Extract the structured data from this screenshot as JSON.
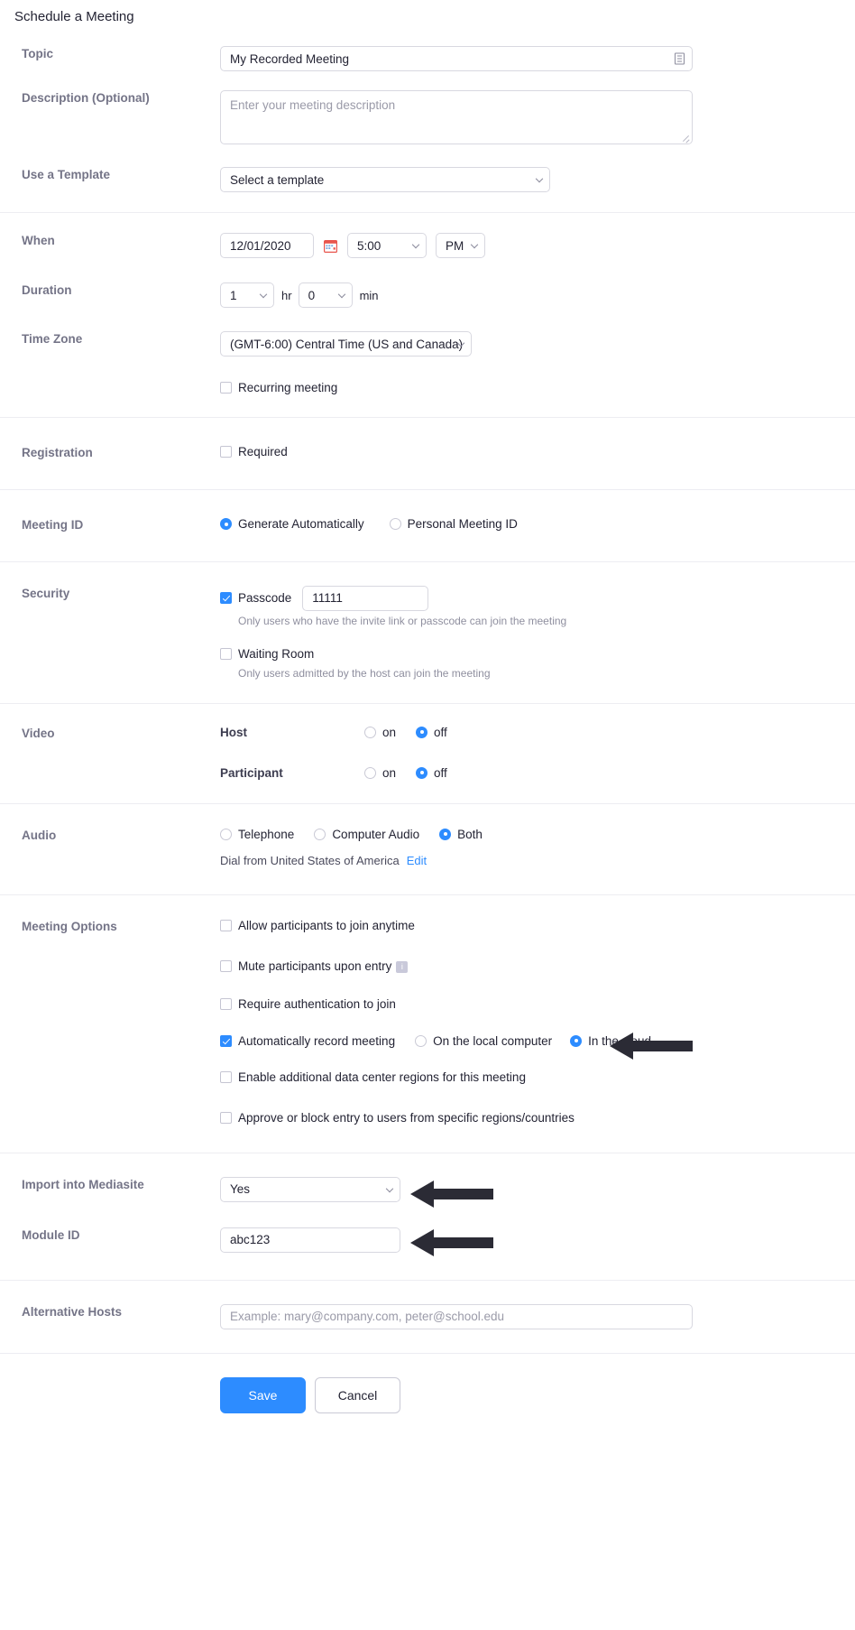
{
  "page": {
    "title": "Schedule a Meeting"
  },
  "topic": {
    "label": "Topic",
    "value": "My Recorded Meeting",
    "icon": "text-field-icon"
  },
  "description": {
    "label": "Description (Optional)",
    "placeholder": "Enter your meeting description",
    "value": ""
  },
  "template": {
    "label": "Use a Template",
    "value": "Select a template",
    "icon": "chevron-down-icon"
  },
  "when": {
    "label": "When",
    "date": "12/01/2020",
    "calendar_icon": "calendar-icon",
    "time": "5:00",
    "meridiem": "PM"
  },
  "duration": {
    "label": "Duration",
    "hours": "1",
    "hours_unit": "hr",
    "minutes": "0",
    "minutes_unit": "min"
  },
  "timezone": {
    "label": "Time Zone",
    "value": "(GMT-6:00) Central Time (US and Canada)"
  },
  "recurring": {
    "label": "Recurring meeting",
    "checked": false
  },
  "registration": {
    "label": "Registration",
    "required_label": "Required",
    "checked": false
  },
  "meeting_id": {
    "label": "Meeting ID",
    "options": [
      {
        "label": "Generate Automatically",
        "selected": true
      },
      {
        "label": "Personal Meeting ID",
        "selected": false
      }
    ]
  },
  "security": {
    "label": "Security",
    "passcode": {
      "label": "Passcode",
      "checked": true,
      "value": "11111",
      "hint": "Only users who have the invite link or passcode can join the meeting"
    },
    "waiting_room": {
      "label": "Waiting Room",
      "checked": false,
      "hint": "Only users admitted by the host can join the meeting"
    }
  },
  "video": {
    "label": "Video",
    "rows": [
      {
        "name": "Host",
        "on_label": "on",
        "off_label": "off",
        "selected": "off"
      },
      {
        "name": "Participant",
        "on_label": "on",
        "off_label": "off",
        "selected": "off"
      }
    ]
  },
  "audio": {
    "label": "Audio",
    "options": [
      {
        "label": "Telephone",
        "selected": false
      },
      {
        "label": "Computer Audio",
        "selected": false
      },
      {
        "label": "Both",
        "selected": true
      }
    ],
    "dial_text": "Dial from United States of America",
    "edit_link": "Edit"
  },
  "meeting_options": {
    "label": "Meeting Options",
    "items": [
      {
        "label": "Allow participants to join anytime",
        "checked": false
      },
      {
        "label": "Mute participants upon entry",
        "checked": false,
        "badge": "info-badge-icon"
      },
      {
        "label": "Require authentication to join",
        "checked": false
      }
    ],
    "record": {
      "label": "Automatically record meeting",
      "checked": true,
      "options": [
        {
          "label": "On the local computer",
          "selected": false
        },
        {
          "label": "In the cloud",
          "selected": true
        }
      ]
    },
    "items_after": [
      {
        "label": "Enable additional data center regions for this meeting",
        "checked": false
      },
      {
        "label": "Approve or block entry to users from specific regions/countries",
        "checked": false
      }
    ]
  },
  "mediasite": {
    "label": "Import into Mediasite",
    "value": "Yes"
  },
  "module_id": {
    "label": "Module ID",
    "value": "abc123"
  },
  "alternative_hosts": {
    "label": "Alternative Hosts",
    "placeholder": "Example: mary@company.com, peter@school.edu",
    "value": ""
  },
  "actions": {
    "save_label": "Save",
    "cancel_label": "Cancel"
  },
  "annotations": {
    "arrow_color": "#2b2b35",
    "arrows": [
      {
        "name": "arrow-pointing-in-the-cloud"
      },
      {
        "name": "arrow-pointing-mediasite-select"
      },
      {
        "name": "arrow-pointing-module-id-input"
      }
    ]
  },
  "colors": {
    "accent": "#2d8cff",
    "label": "#747487",
    "text": "#232333",
    "hint": "#8f8f9f",
    "border": "#d8d8e0"
  }
}
